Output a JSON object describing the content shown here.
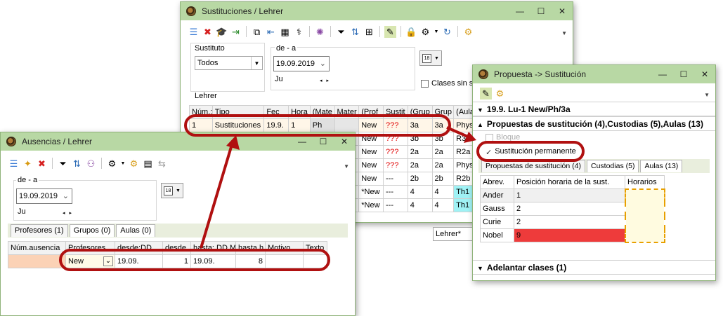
{
  "colors": {
    "titlebar": "#b8d8a4",
    "annotation": "#b01010",
    "cyan_cell": "#9ff2f5",
    "nobel_red": "#ee3b3b",
    "dashed": "#e8a000"
  },
  "sust": {
    "title": "Sustituciones / Lehrer",
    "controls": {
      "min": "—",
      "max": "☐",
      "close": "✕"
    },
    "sustituto_label": "Sustituto",
    "sustituto_value": "Todos",
    "range_label": "de - a",
    "date": "19.09.2019",
    "day": "Ju",
    "clases_label": "Clases sin su",
    "lehrer_label": "Lehrer",
    "lehrer_combo": "Lehrer*",
    "columns": [
      "Núm.:",
      "Tipo",
      "Fec",
      "Hora",
      "(Mate",
      "Mater",
      "(Prof",
      "Sustit",
      "(Grup",
      "Grup",
      "(Aula)"
    ],
    "rows": [
      [
        "1",
        "Sustituciones",
        "19.9.",
        "1",
        "Ph",
        "",
        "New",
        "???",
        "3a",
        "3a",
        "Phys"
      ],
      [
        "",
        "",
        "",
        "",
        "",
        "",
        "New",
        "???",
        "3b",
        "3b",
        "R3"
      ],
      [
        "",
        "",
        "",
        "",
        "",
        "",
        "New",
        "???",
        "2a",
        "2a",
        "R2a"
      ],
      [
        "",
        "",
        "",
        "",
        "",
        "",
        "New",
        "???",
        "2a",
        "2a",
        "Phys"
      ],
      [
        "",
        "",
        "",
        "",
        "",
        "",
        "New",
        "---",
        "2b",
        "2b",
        "R2b"
      ],
      [
        "",
        "",
        "",
        "",
        "",
        "",
        "*New",
        "---",
        "4",
        "4",
        "Th1"
      ],
      [
        "",
        "",
        "",
        "",
        "",
        "",
        "*New",
        "---",
        "4",
        "4",
        "Th1"
      ]
    ]
  },
  "aus": {
    "title": "Ausencias / Lehrer",
    "controls": {
      "min": "—",
      "max": "☐",
      "close": "✕"
    },
    "range_label": "de - a",
    "date": "19.09.2019",
    "day": "Ju",
    "tabs": [
      "Profesores (1)",
      "Grupos (0)",
      "Aulas (0)"
    ],
    "columns": [
      "Núm.ausencia",
      "Profesores",
      "desde:DD",
      "desde",
      "hasta: DD.M",
      "hasta h",
      "Motivo",
      "Texto"
    ],
    "row": [
      "",
      "New",
      "19.09.",
      "1",
      "19.09.",
      "8",
      "",
      ""
    ]
  },
  "prop": {
    "title": "Propuesta -> Sustitución",
    "controls": {
      "min": "—",
      "max": "☐",
      "close": "✕"
    },
    "header": "19.9. Lu-1 New/Ph/3a",
    "section": "Propuestas de sustitución (4),Custodias (5),Aulas (13)",
    "bloque": "Bloque",
    "permanente": "Sustitución permanente",
    "tabs": [
      "Propuestas de sustitución (4)",
      "Custodias (5)",
      "Aulas (13)"
    ],
    "columns": [
      "Abrev.",
      "Posición horaria de la sust.",
      "Horarios"
    ],
    "rows": [
      [
        "Ander",
        "1"
      ],
      [
        "Gauss",
        "2"
      ],
      [
        "Curie",
        "2"
      ],
      [
        "Nobel",
        "9"
      ]
    ],
    "adelantar": "Adelantar clases (1)"
  }
}
